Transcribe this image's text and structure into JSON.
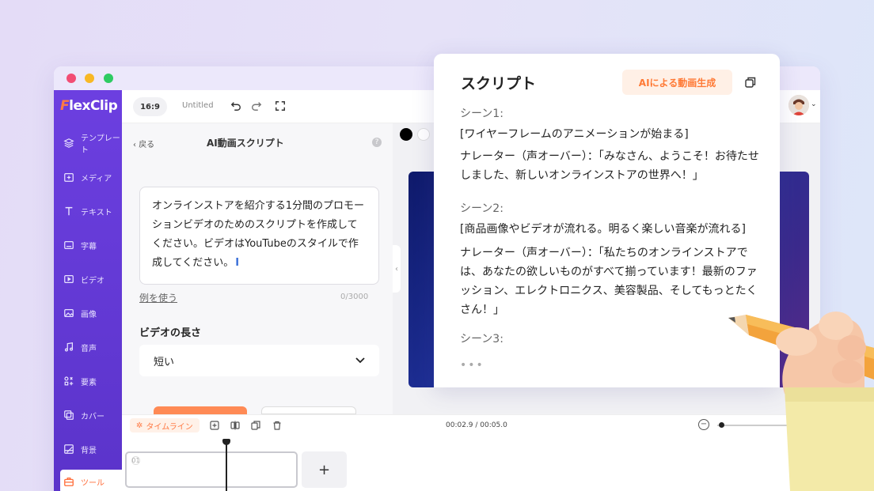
{
  "app": {
    "logo": {
      "flex": "Flex",
      "clip": "Clip",
      "initial": "F"
    },
    "window_dots": [
      "close",
      "minimize",
      "maximize"
    ]
  },
  "sidebar": {
    "items": [
      {
        "label": "テンプレート",
        "icon": "layers-icon",
        "active": false
      },
      {
        "label": "メディア",
        "icon": "media-folder-icon",
        "active": false
      },
      {
        "label": "テキスト",
        "icon": "text-icon",
        "active": false
      },
      {
        "label": "字幕",
        "icon": "subtitle-icon",
        "active": false
      },
      {
        "label": "ビデオ",
        "icon": "video-icon",
        "active": false
      },
      {
        "label": "画像",
        "icon": "image-icon",
        "active": false
      },
      {
        "label": "音声",
        "icon": "music-icon",
        "active": false
      },
      {
        "label": "要素",
        "icon": "elements-icon",
        "active": false
      },
      {
        "label": "カバー",
        "icon": "cover-icon",
        "active": false
      },
      {
        "label": "背景",
        "icon": "background-icon",
        "active": false
      },
      {
        "label": "ツール",
        "icon": "toolbox-icon",
        "active": true
      }
    ]
  },
  "toolbar": {
    "aspect_ratio": "16:9",
    "document_title": "Untitled"
  },
  "panel": {
    "back_label": "戻る",
    "title": "AI動画スクリプト",
    "prompt_text": "オンラインストアを紹介する1分間のプロモーションビデオのためのスクリプトを作成してください。ビデオはYouTubeのスタイルで作成してください。",
    "example_link": "例を使う",
    "char_count": "0/3000",
    "length_label": "ビデオの長さ",
    "length_value": "短い"
  },
  "timeline": {
    "tag": "タイムライン",
    "time": "00:02.9 / 00:05.0",
    "clip_number": "01",
    "add_label": "+"
  },
  "script_card": {
    "title": "スクリプト",
    "ai_button": "AIによる動画生成",
    "scenes": [
      {
        "heading": "シーン1:",
        "action": "[ワイヤーフレームのアニメーションが始まる]",
        "narration": "ナレーター（声オーバー）：「みなさん、ようこそ！お待たせしました、新しいオンラインストアの世界へ！」"
      },
      {
        "heading": "シーン2:",
        "action": "[商品画像やビデオが流れる。明るく楽しい音楽が流れる]",
        "narration": "ナレーター（声オーバー）：「私たちのオンラインストアでは、あなたの欲しいものがすべて揃っています！最新のファッション、エレクトロニクス、美容製品、そしてもっとたくさん！」"
      },
      {
        "heading": "シーン3:"
      }
    ],
    "more": "•••"
  },
  "colors": {
    "sidebar": "#6c3fe0",
    "accent": "#ff7a36",
    "background": "#e4dcf7"
  }
}
